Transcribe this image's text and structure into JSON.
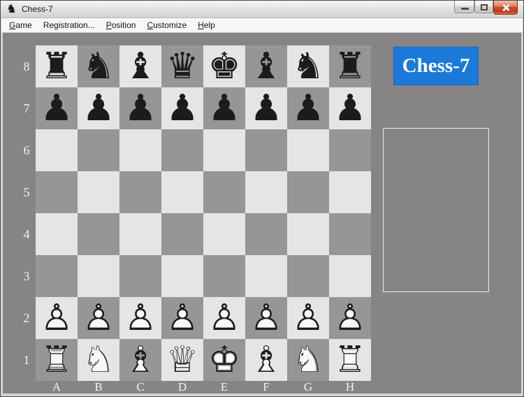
{
  "window": {
    "title": "Chess-7",
    "controls": {
      "minimize": "Minimize",
      "maximize": "Maximize",
      "close": "Close"
    }
  },
  "menu": {
    "items": [
      {
        "label": "Game",
        "underline": 0
      },
      {
        "label": "Registration...",
        "underline": -1
      },
      {
        "label": "Position",
        "underline": 0
      },
      {
        "label": "Customize",
        "underline": 0
      },
      {
        "label": "Help",
        "underline": 0
      }
    ]
  },
  "logo": {
    "text": "Chess-7",
    "background": "#1b79da",
    "text_color": "#ffffff"
  },
  "board": {
    "files": [
      "A",
      "B",
      "C",
      "D",
      "E",
      "F",
      "G",
      "H"
    ],
    "ranks": [
      "8",
      "7",
      "6",
      "5",
      "4",
      "3",
      "2",
      "1"
    ],
    "position_rows": [
      "rnbqkbnr",
      "pppppppp",
      "........",
      "........",
      "........",
      "........",
      "PPPPPPPP",
      "RNBQKBNR"
    ],
    "glyphs_filled": {
      "k": "♚",
      "q": "♛",
      "r": "♜",
      "b": "♝",
      "n": "♞",
      "p": "♟"
    },
    "glyphs_outline": {
      "k": "♔",
      "q": "♕",
      "r": "♖",
      "b": "♗",
      "n": "♘",
      "p": "♙"
    },
    "piece_names": {
      "k": "king",
      "q": "queen",
      "r": "rook",
      "b": "bishop",
      "n": "knight",
      "p": "pawn"
    },
    "colors": {
      "light": "#e7e4e4",
      "dark": "#989595",
      "background": "#878484"
    }
  },
  "side_panel": {
    "text": ""
  },
  "titlebar_icon": "black-knight"
}
